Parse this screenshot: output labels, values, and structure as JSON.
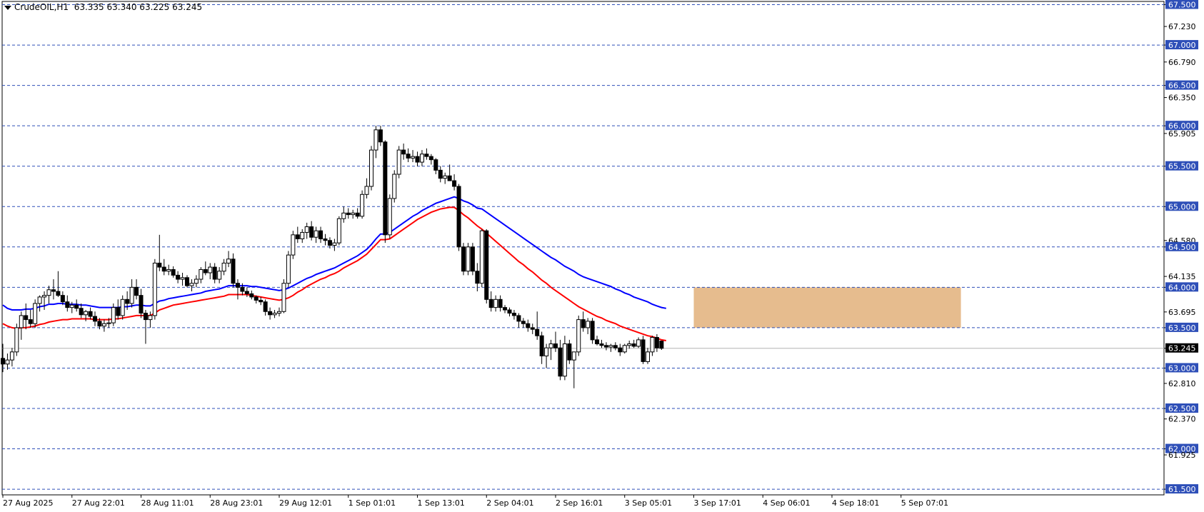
{
  "header": {
    "symbol": "CrudeOIL,H1",
    "ohlc": "63.335 63.340 63.225 63.245"
  },
  "chart_data": {
    "type": "candlestick",
    "symbol": "CrudeOIL",
    "timeframe": "H1",
    "ylim": [
      61.43,
      67.54
    ],
    "y_ticks": [
      "67.500",
      "67.230",
      "67.000",
      "66.790",
      "66.500",
      "66.350",
      "66.000",
      "65.905",
      "65.500",
      "65.000",
      "64.580",
      "64.500",
      "64.135",
      "64.000",
      "63.695",
      "63.500",
      "63.245",
      "63.000",
      "62.810",
      "62.500",
      "62.370",
      "62.000",
      "61.925",
      "61.500"
    ],
    "y_tick_values": [
      67.5,
      67.23,
      67.0,
      66.79,
      66.5,
      66.35,
      66.0,
      65.905,
      65.5,
      65.0,
      64.58,
      64.5,
      64.135,
      64.0,
      63.695,
      63.5,
      63.245,
      63.0,
      62.81,
      62.5,
      62.37,
      62.0,
      61.925,
      61.5
    ],
    "horizontal_levels": [
      67.5,
      67.0,
      66.5,
      66.0,
      65.5,
      65.0,
      64.5,
      64.0,
      63.5,
      63.0,
      62.5,
      62.0,
      61.5
    ],
    "level_labels": [
      "67.500",
      "67.000",
      "66.500",
      "66.000",
      "65.500",
      "65.000",
      "64.500",
      "64.000",
      "63.500",
      "63.000",
      "62.500",
      "62.000",
      "61.500"
    ],
    "current_price": 63.245,
    "current_price_label": "63.245",
    "x_labels": [
      "27 Aug 2025",
      "27 Aug 22:01",
      "28 Aug 11:01",
      "28 Aug 23:01",
      "29 Aug 12:01",
      "1 Sep 01:01",
      "1 Sep 13:01",
      "2 Sep 04:01",
      "2 Sep 16:01",
      "3 Sep 05:01",
      "3 Sep 17:01",
      "4 Sep 06:01",
      "4 Sep 18:01",
      "5 Sep 07:01"
    ],
    "x_label_bar_index": [
      0,
      15,
      30,
      45,
      60,
      75,
      90,
      105,
      120,
      135,
      150,
      165,
      180,
      195
    ],
    "candles": [
      [
        63.12,
        63.3,
        62.95,
        63.05
      ],
      [
        63.05,
        63.18,
        62.98,
        63.1
      ],
      [
        63.1,
        63.25,
        63.02,
        63.2
      ],
      [
        63.2,
        63.55,
        63.15,
        63.5
      ],
      [
        63.5,
        63.7,
        63.35,
        63.65
      ],
      [
        63.65,
        63.8,
        63.48,
        63.6
      ],
      [
        63.6,
        63.72,
        63.5,
        63.55
      ],
      [
        63.55,
        63.85,
        63.5,
        63.8
      ],
      [
        63.8,
        63.9,
        63.7,
        63.88
      ],
      [
        63.88,
        63.95,
        63.72,
        63.9
      ],
      [
        63.9,
        64.02,
        63.8,
        63.97
      ],
      [
        63.97,
        64.1,
        63.85,
        63.95
      ],
      [
        63.95,
        64.2,
        63.88,
        63.9
      ],
      [
        63.9,
        63.95,
        63.78,
        63.82
      ],
      [
        63.82,
        63.9,
        63.7,
        63.75
      ],
      [
        63.75,
        63.82,
        63.68,
        63.78
      ],
      [
        63.78,
        63.85,
        63.7,
        63.74
      ],
      [
        63.74,
        63.8,
        63.62,
        63.66
      ],
      [
        63.66,
        63.72,
        63.58,
        63.7
      ],
      [
        63.7,
        63.75,
        63.6,
        63.64
      ],
      [
        63.64,
        63.7,
        63.52,
        63.58
      ],
      [
        63.58,
        63.62,
        63.48,
        63.52
      ],
      [
        63.52,
        63.6,
        63.45,
        63.55
      ],
      [
        63.55,
        63.62,
        63.5,
        63.56
      ],
      [
        63.56,
        63.8,
        63.52,
        63.75
      ],
      [
        63.75,
        63.85,
        63.6,
        63.65
      ],
      [
        63.65,
        63.9,
        63.6,
        63.85
      ],
      [
        63.85,
        63.95,
        63.72,
        63.8
      ],
      [
        63.8,
        64.1,
        63.75,
        64.0
      ],
      [
        64.0,
        64.1,
        63.85,
        63.9
      ],
      [
        63.9,
        63.98,
        63.62,
        63.68
      ],
      [
        63.68,
        63.72,
        63.3,
        63.6
      ],
      [
        63.6,
        63.7,
        63.5,
        63.65
      ],
      [
        63.65,
        64.35,
        63.6,
        64.3
      ],
      [
        64.3,
        64.65,
        64.2,
        64.25
      ],
      [
        64.25,
        64.35,
        64.15,
        64.2
      ],
      [
        64.2,
        64.28,
        64.15,
        64.22
      ],
      [
        64.22,
        64.26,
        64.12,
        64.15
      ],
      [
        64.15,
        64.2,
        64.05,
        64.1
      ],
      [
        64.1,
        64.18,
        64.02,
        64.12
      ],
      [
        64.12,
        64.15,
        64.0,
        64.02
      ],
      [
        64.02,
        64.1,
        63.95,
        64.05
      ],
      [
        64.05,
        64.15,
        64.0,
        64.1
      ],
      [
        64.1,
        64.25,
        64.05,
        64.22
      ],
      [
        64.22,
        64.32,
        64.15,
        64.18
      ],
      [
        64.18,
        64.3,
        64.1,
        64.25
      ],
      [
        64.25,
        64.3,
        64.05,
        64.1
      ],
      [
        64.1,
        64.25,
        64.05,
        64.2
      ],
      [
        64.2,
        64.35,
        64.15,
        64.3
      ],
      [
        64.3,
        64.45,
        64.25,
        64.35
      ],
      [
        64.35,
        64.42,
        64.0,
        64.05
      ],
      [
        64.05,
        64.1,
        63.85,
        64.0
      ],
      [
        64.0,
        64.05,
        63.9,
        63.95
      ],
      [
        63.95,
        64.0,
        63.88,
        63.92
      ],
      [
        63.92,
        63.96,
        63.85,
        63.88
      ],
      [
        63.88,
        63.9,
        63.8,
        63.84
      ],
      [
        63.84,
        63.88,
        63.78,
        63.82
      ],
      [
        63.82,
        63.85,
        63.65,
        63.7
      ],
      [
        63.7,
        63.75,
        63.6,
        63.66
      ],
      [
        63.66,
        63.72,
        63.62,
        63.68
      ],
      [
        63.68,
        63.75,
        63.64,
        63.7
      ],
      [
        63.7,
        64.1,
        63.68,
        64.05
      ],
      [
        64.05,
        64.45,
        64.0,
        64.4
      ],
      [
        64.4,
        64.7,
        64.35,
        64.65
      ],
      [
        64.65,
        64.75,
        64.55,
        64.6
      ],
      [
        64.6,
        64.72,
        64.55,
        64.68
      ],
      [
        64.68,
        64.8,
        64.6,
        64.75
      ],
      [
        64.75,
        64.82,
        64.58,
        64.62
      ],
      [
        64.62,
        64.75,
        64.55,
        64.7
      ],
      [
        64.7,
        64.75,
        64.55,
        64.6
      ],
      [
        64.6,
        64.66,
        64.52,
        64.58
      ],
      [
        64.58,
        64.62,
        64.48,
        64.52
      ],
      [
        64.52,
        64.6,
        64.45,
        64.55
      ],
      [
        64.55,
        64.88,
        64.52,
        64.85
      ],
      [
        64.85,
        65.0,
        64.8,
        64.92
      ],
      [
        64.92,
        64.98,
        64.85,
        64.9
      ],
      [
        64.9,
        64.96,
        64.85,
        64.92
      ],
      [
        64.92,
        64.98,
        64.85,
        64.88
      ],
      [
        64.88,
        65.2,
        64.85,
        65.15
      ],
      [
        65.15,
        65.35,
        65.1,
        65.25
      ],
      [
        65.25,
        65.75,
        65.2,
        65.7
      ],
      [
        65.7,
        66.0,
        65.6,
        65.95
      ],
      [
        65.95,
        66.0,
        65.75,
        65.8
      ],
      [
        65.8,
        65.82,
        64.55,
        64.65
      ],
      [
        64.65,
        65.15,
        64.6,
        65.1
      ],
      [
        65.1,
        65.45,
        65.05,
        65.4
      ],
      [
        65.4,
        65.75,
        65.35,
        65.7
      ],
      [
        65.7,
        65.78,
        65.58,
        65.65
      ],
      [
        65.65,
        65.72,
        65.55,
        65.6
      ],
      [
        65.6,
        65.7,
        65.55,
        65.62
      ],
      [
        65.62,
        65.68,
        65.5,
        65.55
      ],
      [
        65.55,
        65.7,
        65.5,
        65.65
      ],
      [
        65.65,
        65.72,
        65.58,
        65.62
      ],
      [
        65.62,
        65.65,
        65.52,
        65.58
      ],
      [
        65.58,
        65.6,
        65.4,
        65.45
      ],
      [
        65.45,
        65.5,
        65.3,
        65.35
      ],
      [
        65.35,
        65.42,
        65.28,
        65.38
      ],
      [
        65.38,
        65.52,
        65.35,
        65.32
      ],
      [
        65.32,
        65.4,
        65.2,
        65.25
      ],
      [
        65.25,
        65.28,
        64.45,
        64.5
      ],
      [
        64.5,
        64.55,
        64.15,
        64.2
      ],
      [
        64.2,
        64.55,
        64.15,
        64.5
      ],
      [
        64.5,
        64.55,
        64.15,
        64.2
      ],
      [
        64.2,
        64.3,
        63.95,
        64.05
      ],
      [
        64.05,
        64.72,
        64.0,
        64.7
      ],
      [
        64.7,
        64.72,
        63.8,
        63.85
      ],
      [
        63.85,
        63.95,
        63.7,
        63.75
      ],
      [
        63.75,
        63.9,
        63.7,
        63.85
      ],
      [
        63.85,
        63.9,
        63.7,
        63.75
      ],
      [
        63.75,
        63.78,
        63.68,
        63.72
      ],
      [
        63.72,
        63.75,
        63.64,
        63.68
      ],
      [
        63.68,
        63.72,
        63.6,
        63.65
      ],
      [
        63.65,
        63.68,
        63.5,
        63.58
      ],
      [
        63.58,
        63.62,
        63.5,
        63.55
      ],
      [
        63.55,
        63.6,
        63.45,
        63.5
      ],
      [
        63.5,
        63.55,
        63.42,
        63.48
      ],
      [
        63.48,
        63.7,
        63.35,
        63.4
      ],
      [
        63.4,
        63.45,
        63.05,
        63.15
      ],
      [
        63.15,
        63.3,
        63.0,
        63.25
      ],
      [
        63.25,
        63.35,
        63.1,
        63.3
      ],
      [
        63.3,
        63.45,
        63.2,
        63.25
      ],
      [
        63.25,
        63.35,
        62.85,
        62.9
      ],
      [
        62.9,
        63.4,
        62.85,
        63.3
      ],
      [
        63.3,
        63.35,
        63.05,
        63.1
      ],
      [
        63.1,
        63.2,
        62.75,
        63.2
      ],
      [
        63.2,
        63.65,
        63.15,
        63.6
      ],
      [
        63.6,
        63.7,
        63.45,
        63.5
      ],
      [
        63.5,
        63.62,
        63.42,
        63.58
      ],
      [
        63.58,
        63.62,
        63.3,
        63.35
      ],
      [
        63.35,
        63.4,
        63.28,
        63.3
      ],
      [
        63.3,
        63.35,
        63.25,
        63.28
      ],
      [
        63.28,
        63.32,
        63.22,
        63.26
      ],
      [
        63.26,
        63.3,
        63.2,
        63.28
      ],
      [
        63.28,
        63.32,
        63.22,
        63.25
      ],
      [
        63.25,
        63.3,
        63.15,
        63.2
      ],
      [
        63.2,
        63.3,
        63.18,
        63.28
      ],
      [
        63.28,
        63.34,
        63.24,
        63.3
      ],
      [
        63.3,
        63.35,
        63.25,
        63.27
      ],
      [
        63.27,
        63.38,
        63.25,
        63.35
      ],
      [
        63.35,
        63.4,
        63.05,
        63.08
      ],
      [
        63.08,
        63.25,
        63.05,
        63.2
      ],
      [
        63.2,
        63.4,
        63.15,
        63.38
      ],
      [
        63.38,
        63.42,
        63.2,
        63.25
      ],
      [
        63.335,
        63.34,
        63.225,
        63.245
      ]
    ],
    "series": [
      {
        "color": "#0000ff",
        "values": [
          63.78,
          63.74,
          63.72,
          63.72,
          63.72,
          63.73,
          63.73,
          63.74,
          63.76,
          63.77,
          63.79,
          63.79,
          63.8,
          63.8,
          63.79,
          63.79,
          63.79,
          63.78,
          63.78,
          63.77,
          63.76,
          63.75,
          63.75,
          63.75,
          63.75,
          63.75,
          63.76,
          63.76,
          63.77,
          63.78,
          63.78,
          63.77,
          63.77,
          63.8,
          63.83,
          63.84,
          63.86,
          63.87,
          63.88,
          63.89,
          63.9,
          63.91,
          63.92,
          63.93,
          63.95,
          63.96,
          63.97,
          63.98,
          64.0,
          64.02,
          64.02,
          64.02,
          64.02,
          64.02,
          64.01,
          64.01,
          64.0,
          63.99,
          63.98,
          63.97,
          63.96,
          63.97,
          63.99,
          64.02,
          64.05,
          64.08,
          64.11,
          64.13,
          64.16,
          64.18,
          64.2,
          64.22,
          64.24,
          64.27,
          64.3,
          64.33,
          64.36,
          64.39,
          64.43,
          64.47,
          64.53,
          64.6,
          64.66,
          64.66,
          64.68,
          64.72,
          64.76,
          64.8,
          64.84,
          64.88,
          64.91,
          64.95,
          64.98,
          65.01,
          65.04,
          65.06,
          65.08,
          65.1,
          65.12,
          65.1,
          65.07,
          65.05,
          65.02,
          64.98,
          64.97,
          64.93,
          64.89,
          64.85,
          64.81,
          64.77,
          64.73,
          64.69,
          64.65,
          64.61,
          64.57,
          64.53,
          64.49,
          64.45,
          64.41,
          64.37,
          64.34,
          64.3,
          64.26,
          64.23,
          64.2,
          64.16,
          64.13,
          64.11,
          64.09,
          64.07,
          64.05,
          64.03,
          64.01,
          63.98,
          63.96,
          63.93,
          63.91,
          63.88,
          63.86,
          63.84,
          63.82,
          63.79,
          63.77,
          63.75,
          63.74
        ]
      },
      {
        "color": "#ff0000",
        "values": [
          63.55,
          63.52,
          63.5,
          63.49,
          63.5,
          63.5,
          63.51,
          63.52,
          63.54,
          63.55,
          63.57,
          63.58,
          63.59,
          63.6,
          63.6,
          63.61,
          63.61,
          63.61,
          63.61,
          63.61,
          63.6,
          63.6,
          63.6,
          63.6,
          63.61,
          63.61,
          63.62,
          63.63,
          63.64,
          63.65,
          63.65,
          63.65,
          63.65,
          63.68,
          63.72,
          63.74,
          63.76,
          63.78,
          63.79,
          63.8,
          63.81,
          63.82,
          63.83,
          63.84,
          63.85,
          63.86,
          63.87,
          63.88,
          63.89,
          63.91,
          63.91,
          63.91,
          63.91,
          63.91,
          63.9,
          63.89,
          63.88,
          63.87,
          63.86,
          63.85,
          63.84,
          63.85,
          63.87,
          63.9,
          63.94,
          63.97,
          64.01,
          64.04,
          64.07,
          64.1,
          64.12,
          64.15,
          64.17,
          64.2,
          64.24,
          64.27,
          64.3,
          64.33,
          64.37,
          64.41,
          64.47,
          64.53,
          64.59,
          64.59,
          64.6,
          64.64,
          64.68,
          64.72,
          64.76,
          64.8,
          64.84,
          64.87,
          64.9,
          64.93,
          64.95,
          64.97,
          64.98,
          64.99,
          64.99,
          64.95,
          64.9,
          64.86,
          64.81,
          64.76,
          64.72,
          64.67,
          64.62,
          64.57,
          64.52,
          64.47,
          64.42,
          64.37,
          64.32,
          64.28,
          64.23,
          64.19,
          64.14,
          64.09,
          64.05,
          64.0,
          63.96,
          63.92,
          63.88,
          63.84,
          63.8,
          63.76,
          63.73,
          63.7,
          63.67,
          63.64,
          63.62,
          63.59,
          63.57,
          63.55,
          63.52,
          63.5,
          63.48,
          63.46,
          63.44,
          63.42,
          63.4,
          63.39,
          63.37,
          63.35,
          63.34
        ]
      }
    ],
    "zone": {
      "from_index": 150,
      "to_index": 208,
      "low": 63.5,
      "high": 64.0,
      "color": "#e2b07a"
    }
  }
}
